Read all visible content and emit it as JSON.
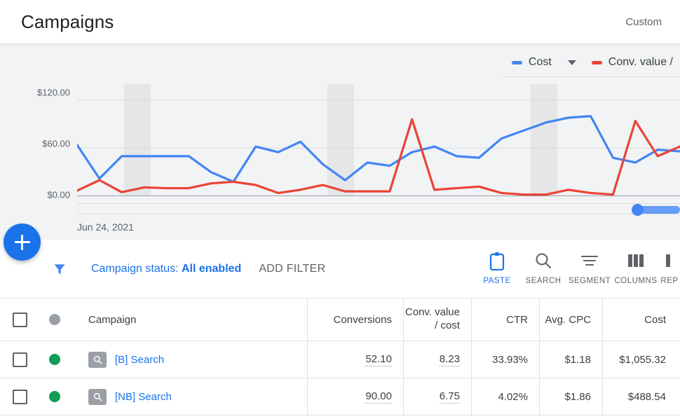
{
  "header": {
    "title": "Campaigns",
    "date_range": "Custom"
  },
  "chart": {
    "legend": [
      {
        "label": "Cost",
        "color": "#4285f4",
        "has_caret": true
      },
      {
        "label": "Conv. value /",
        "color": "#ea4335",
        "has_caret": false
      }
    ],
    "y_ticks": [
      "$120.00",
      "$60.00",
      "$0.00"
    ],
    "x_start_label": "Jun 24, 2021",
    "scrollbar": {
      "position": "right"
    }
  },
  "chart_data": {
    "type": "line",
    "title": "",
    "xlabel": "",
    "ylabel": "",
    "ylim": [
      0,
      140
    ],
    "y_ticks": [
      0,
      60,
      120
    ],
    "y_tick_labels": [
      "$0.00",
      "$60.00",
      "$120.00"
    ],
    "grid": true,
    "legend_position": "top-right",
    "x_start": "Jun 24, 2021",
    "x": [
      0,
      1,
      2,
      3,
      4,
      5,
      6,
      7,
      8,
      9,
      10,
      11,
      12,
      13,
      14,
      15,
      16,
      17,
      18,
      19,
      20,
      21,
      22,
      23,
      24,
      25,
      26,
      27
    ],
    "shaded_bands": [
      [
        2.1,
        3.3
      ],
      [
        11.2,
        12.4
      ],
      [
        20.3,
        21.5
      ]
    ],
    "series": [
      {
        "name": "Cost",
        "color": "#4285f4",
        "values": [
          64,
          22,
          50,
          50,
          50,
          50,
          30,
          18,
          62,
          55,
          68,
          40,
          20,
          42,
          38,
          55,
          62,
          50,
          48,
          72,
          82,
          92,
          98,
          100,
          48,
          42,
          58,
          56
        ]
      },
      {
        "name": "Conv. value / cost",
        "color": "#ea4335",
        "values": [
          7,
          20,
          5,
          11,
          10,
          10,
          16,
          18,
          14,
          4,
          8,
          14,
          6,
          6,
          6,
          96,
          8,
          10,
          12,
          4,
          2,
          2,
          8,
          4,
          2,
          94,
          50,
          62
        ]
      }
    ]
  },
  "filters": {
    "funnel_icon": "filter-funnel-icon",
    "chip_prefix": "Campaign status: ",
    "chip_value": "All enabled",
    "add_filter_label": "ADD FILTER"
  },
  "toolbar": [
    {
      "label": "PASTE",
      "icon": "clipboard-icon",
      "active": true
    },
    {
      "label": "SEARCH",
      "icon": "search-icon",
      "active": false
    },
    {
      "label": "SEGMENT",
      "icon": "segment-icon",
      "active": false
    },
    {
      "label": "COLUMNS",
      "icon": "columns-icon",
      "active": false
    },
    {
      "label": "REP",
      "icon": "reports-icon",
      "active": false
    }
  ],
  "table": {
    "columns": {
      "campaign": "Campaign",
      "conversions": "Conversions",
      "conv_value_line1": "Conv. value",
      "conv_value_line2": "/ cost",
      "ctr": "CTR",
      "avg_cpc": "Avg. CPC",
      "cost": "Cost"
    },
    "header_status_color": "#9aa0a6",
    "rows": [
      {
        "name": "[B] Search",
        "status_color": "#0f9d58",
        "conversions": "52.10",
        "conv_value_cost": "8.23",
        "ctr": "33.93%",
        "avg_cpc": "$1.18",
        "cost": "$1,055.32"
      },
      {
        "name": "[NB] Search",
        "status_color": "#0f9d58",
        "conversions": "90.00",
        "conv_value_cost": "6.75",
        "ctr": "4.02%",
        "avg_cpc": "$1.86",
        "cost": "$488.54"
      }
    ]
  },
  "fab": {
    "icon": "plus-icon"
  },
  "colors": {
    "accent_blue": "#1a73e8",
    "cost_line": "#4285f4",
    "conv_line": "#ea4335",
    "status_green": "#0f9d58",
    "chart_bg": "#f1f3f4",
    "band": "#e4e6e8"
  }
}
